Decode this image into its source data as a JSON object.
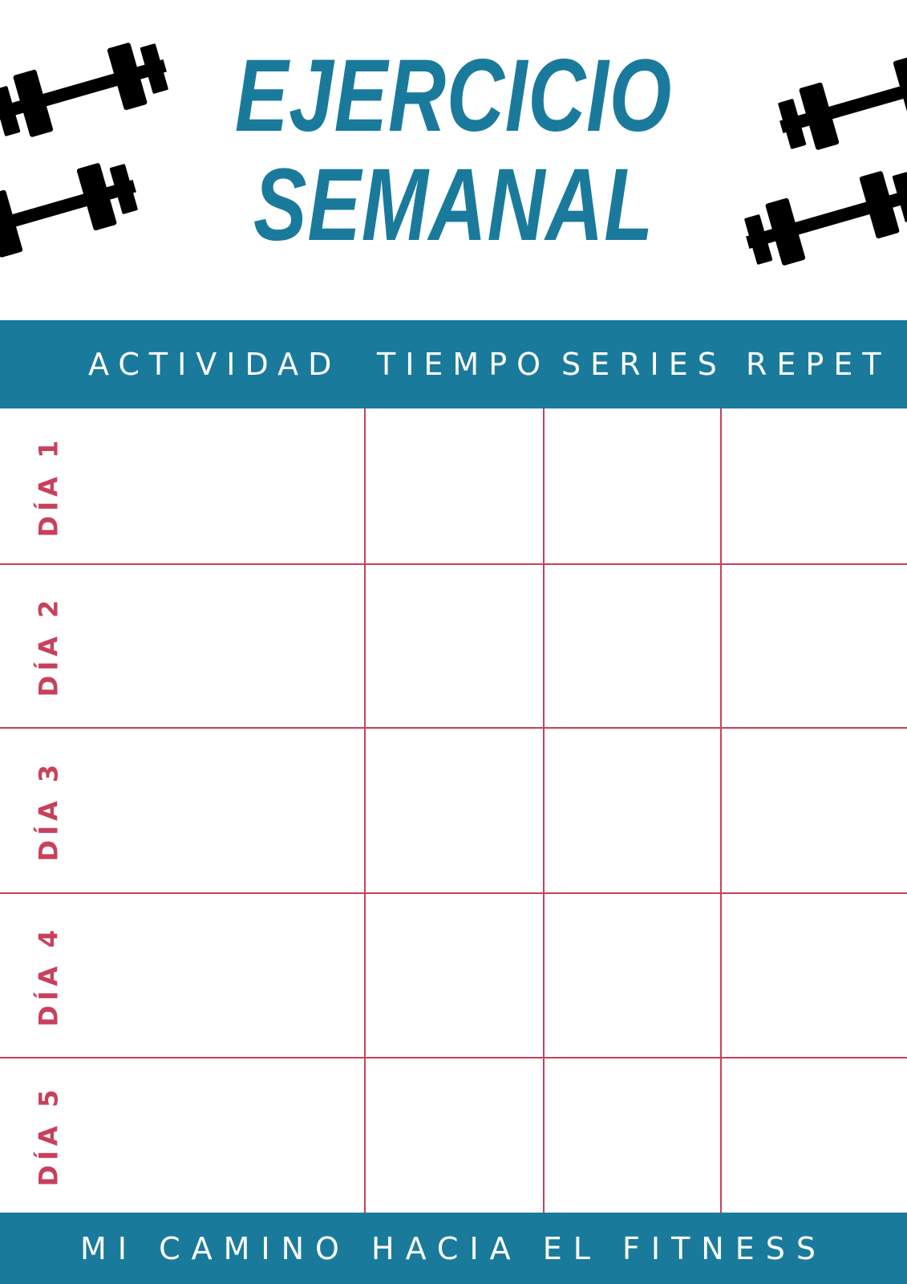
{
  "title": {
    "line1": "EJERCICIO",
    "line2": "SEMANAL"
  },
  "table": {
    "columns": [
      "ACTIVIDAD",
      "TIEMPO",
      "SERIES",
      "REPET"
    ],
    "days": [
      "DÍA 1",
      "DÍA 2",
      "DÍA 3",
      "DÍA 4",
      "DÍA 5"
    ]
  },
  "footer": {
    "text": "MI CAMINO HACIA EL FITNESS"
  },
  "colors": {
    "primary": "#1a7a9c",
    "accent": "#c8405c",
    "icon": "#000000"
  },
  "icons": [
    "dumbbell-icon"
  ]
}
